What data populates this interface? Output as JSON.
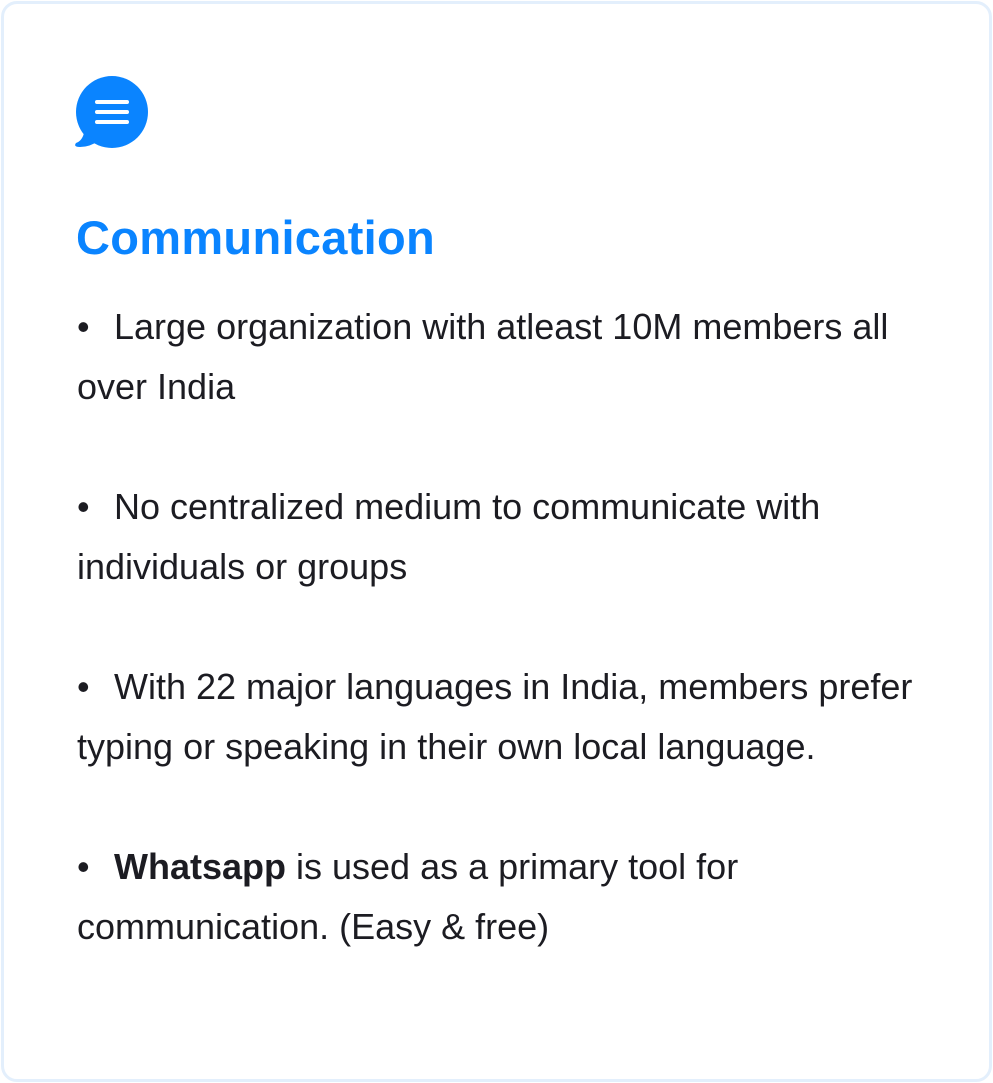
{
  "colors": {
    "accent": "#0a84ff",
    "text": "#1c1c22",
    "border": "#e3effc"
  },
  "icon": "chat-bubble-menu-icon",
  "title": "Communication",
  "items": [
    {
      "text": "Large organization with atleast 10M members all over India"
    },
    {
      "text": "No centralized medium to communicate with individuals or groups"
    },
    {
      "text": "With 22 major languages in India, members prefer typing or speaking in their own local language."
    },
    {
      "bold": "Whatsapp",
      "text": " is used as a primary tool for communication. (Easy & free)"
    }
  ],
  "bullet": "•"
}
